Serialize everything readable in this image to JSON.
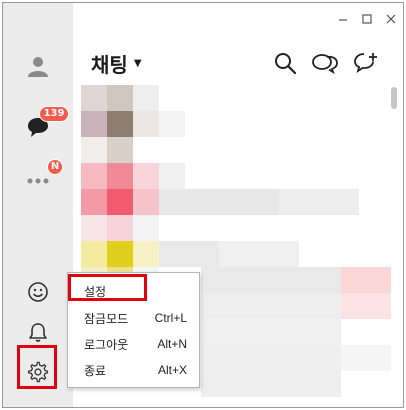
{
  "window": {
    "controls": [
      "minimize",
      "maximize",
      "close"
    ]
  },
  "sidebar": {
    "items": [
      {
        "name": "friends",
        "icon": "person-icon"
      },
      {
        "name": "chats",
        "icon": "chat-bubble-icon",
        "badge": "139"
      },
      {
        "name": "more",
        "icon": "more-dots-icon",
        "badge": "N"
      },
      {
        "name": "emoticon",
        "icon": "smiley-icon"
      },
      {
        "name": "notifications",
        "icon": "bell-icon"
      },
      {
        "name": "settings",
        "icon": "gear-icon"
      }
    ]
  },
  "header": {
    "title": "채팅",
    "toolbar": [
      "search-icon",
      "open-chat-icon",
      "new-chat-icon"
    ]
  },
  "context_menu": {
    "items": [
      {
        "label": "설정",
        "shortcut": ""
      },
      {
        "label": "잠금모드",
        "shortcut": "Ctrl+L"
      },
      {
        "label": "로그아웃",
        "shortcut": "Alt+N"
      },
      {
        "label": "종료",
        "shortcut": "Alt+X"
      }
    ]
  },
  "colors": {
    "accent_badge": "#f15b4d",
    "highlight": "#e00010",
    "sidebar_bg": "#ececec"
  }
}
